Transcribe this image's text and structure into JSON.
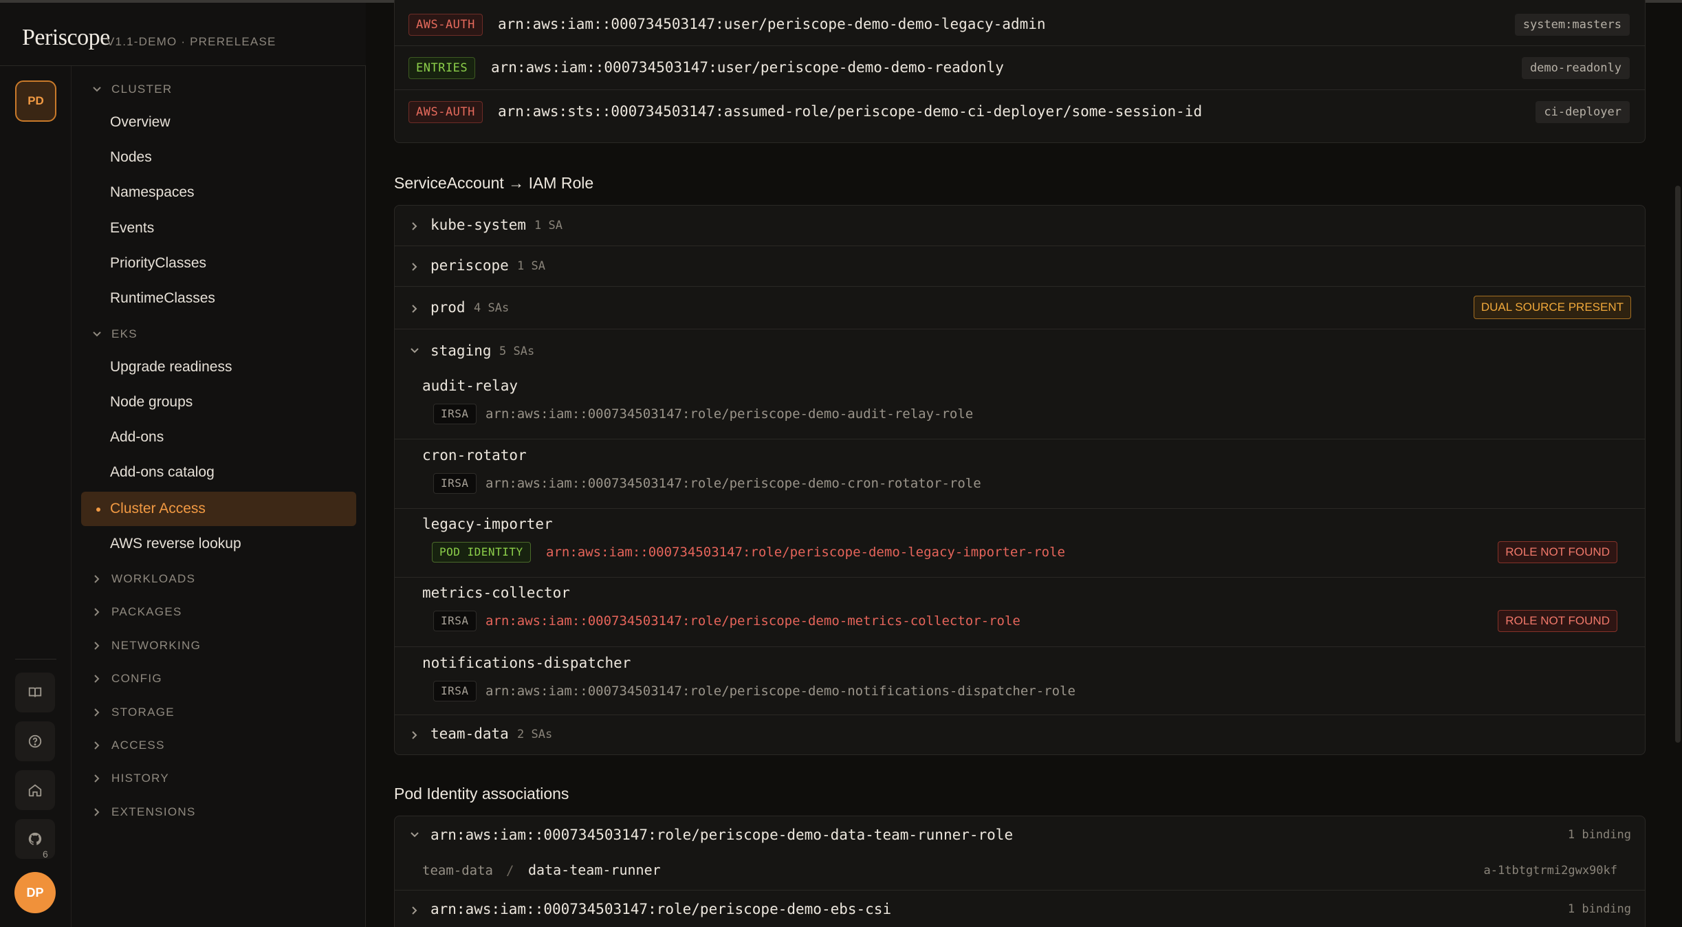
{
  "app": {
    "brand": "Periscope",
    "version": "V1.1-DEMO · PRERELEASE",
    "workspace_badge": "PD",
    "avatar": "DP",
    "github_count": "6"
  },
  "sidebar": {
    "cluster_label": "CLUSTER",
    "cluster_items": [
      "Overview",
      "Nodes",
      "Namespaces",
      "Events",
      "PriorityClasses",
      "RuntimeClasses"
    ],
    "eks_label": "EKS",
    "eks_items": [
      "Upgrade readiness",
      "Node groups",
      "Add-ons",
      "Add-ons catalog",
      "Cluster Access",
      "AWS reverse lookup"
    ],
    "active": "Cluster Access",
    "collapsed_sections": [
      "WORKLOADS",
      "PACKAGES",
      "NETWORKING",
      "CONFIG",
      "STORAGE",
      "ACCESS",
      "HISTORY",
      "EXTENSIONS"
    ]
  },
  "access_entries": [
    {
      "source": "AWS-AUTH",
      "arn": "arn:aws:iam::000734503147:user/periscope-demo-demo-legacy-admin",
      "group": "system:masters"
    },
    {
      "source": "ENTRIES",
      "arn": "arn:aws:iam::000734503147:user/periscope-demo-demo-readonly",
      "group": "demo-readonly"
    },
    {
      "source": "AWS-AUTH",
      "arn": "arn:aws:sts::000734503147:assumed-role/periscope-demo-ci-deployer/some-session-id",
      "group": "ci-deployer"
    }
  ],
  "sa_section": {
    "title": "ServiceAccount → IAM Role",
    "namespaces": [
      {
        "name": "kube-system",
        "count": "1 SA"
      },
      {
        "name": "periscope",
        "count": "1 SA"
      },
      {
        "name": "prod",
        "count": "4 SAs",
        "badge": "DUAL SOURCE PRESENT"
      },
      {
        "name": "staging",
        "count": "5 SAs"
      },
      {
        "name": "team-data",
        "count": "2 SAs"
      }
    ],
    "staging_sas": [
      {
        "name": "audit-relay",
        "type": "IRSA",
        "arn": "arn:aws:iam::000734503147:role/periscope-demo-audit-relay-role"
      },
      {
        "name": "cron-rotator",
        "type": "IRSA",
        "arn": "arn:aws:iam::000734503147:role/periscope-demo-cron-rotator-role"
      },
      {
        "name": "legacy-importer",
        "type": "POD IDENTITY",
        "arn": "arn:aws:iam::000734503147:role/periscope-demo-legacy-importer-role",
        "badge": "ROLE NOT FOUND"
      },
      {
        "name": "metrics-collector",
        "type": "IRSA",
        "arn": "arn:aws:iam::000734503147:role/periscope-demo-metrics-collector-role",
        "badge": "ROLE NOT FOUND"
      },
      {
        "name": "notifications-dispatcher",
        "type": "IRSA",
        "arn": "arn:aws:iam::000734503147:role/periscope-demo-notifications-dispatcher-role"
      }
    ]
  },
  "pod_identity": {
    "title": "Pod Identity associations",
    "roles": [
      {
        "arn": "arn:aws:iam::000734503147:role/periscope-demo-data-team-runner-role",
        "bindings": "1 binding",
        "namespace": "team-data",
        "separator": "/",
        "sa": "data-team-runner",
        "assoc_id": "a-1tbtgtrmi2gwx90kf"
      },
      {
        "arn": "arn:aws:iam::000734503147:role/periscope-demo-ebs-csi",
        "bindings": "1 binding"
      }
    ]
  }
}
